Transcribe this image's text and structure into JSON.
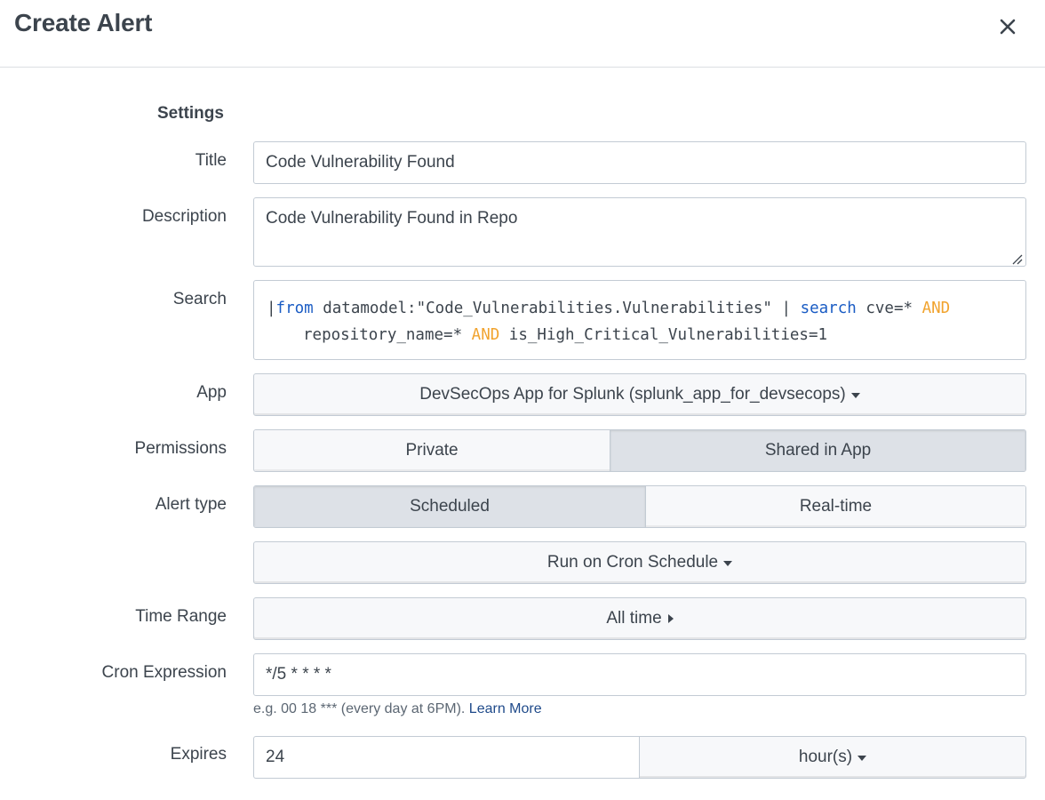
{
  "dialog": {
    "title": "Create Alert",
    "close_icon": "close-icon"
  },
  "settings": {
    "section_label": "Settings",
    "title_label": "Title",
    "title_value": "Code Vulnerability Found",
    "description_label": "Description",
    "description_value": "Code Vulnerability Found in Repo",
    "search_label": "Search",
    "search_query": {
      "pipe1": "|",
      "from_kw": "from",
      "datamodel_part": " datamodel:\"Code_Vulnerabilities.Vulnerabilities\" | ",
      "search_kw": "search",
      "cve_part": " cve=* ",
      "and1": "AND",
      "repo_part": "repository_name=* ",
      "and2": "AND",
      "high_part": " is_High_Critical_Vulnerabilities=1"
    },
    "app_label": "App",
    "app_value": "DevSecOps App for Splunk (splunk_app_for_devsecops)",
    "permissions_label": "Permissions",
    "permissions_options": [
      "Private",
      "Shared in App"
    ],
    "permissions_selected": "Shared in App",
    "alert_type_label": "Alert type",
    "alert_type_options": [
      "Scheduled",
      "Real-time"
    ],
    "alert_type_selected": "Scheduled",
    "schedule_value": "Run on Cron Schedule",
    "time_range_label": "Time Range",
    "time_range_value": "All time",
    "cron_label": "Cron Expression",
    "cron_value": "*/5 * * * *",
    "cron_help": "e.g. 00 18 *** (every day at 6PM).",
    "cron_help_link": "Learn More",
    "expires_label": "Expires",
    "expires_value": "24",
    "expires_unit": "hour(s)"
  }
}
